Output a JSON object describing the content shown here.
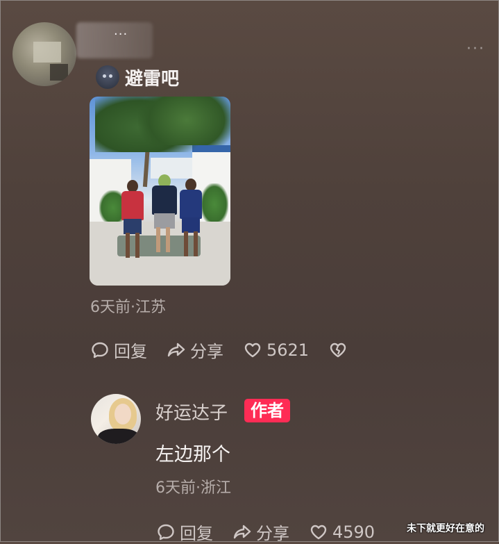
{
  "comment": {
    "user": {
      "name": "..."
    },
    "badge_label": "避雷吧",
    "time_location": "6天前·江苏",
    "actions": {
      "reply": "回复",
      "share": "分享",
      "like_count": "5621"
    }
  },
  "reply": {
    "user": {
      "name": "好运达子",
      "tag": "作者"
    },
    "text": "左边那个",
    "time_location": "6天前·浙江",
    "actions": {
      "reply": "回复",
      "share": "分享",
      "like_count": "4590"
    }
  },
  "watermark": "未下就更好在意的",
  "colors": {
    "author_tag": "#fe2c55",
    "background": "#4f413b"
  }
}
